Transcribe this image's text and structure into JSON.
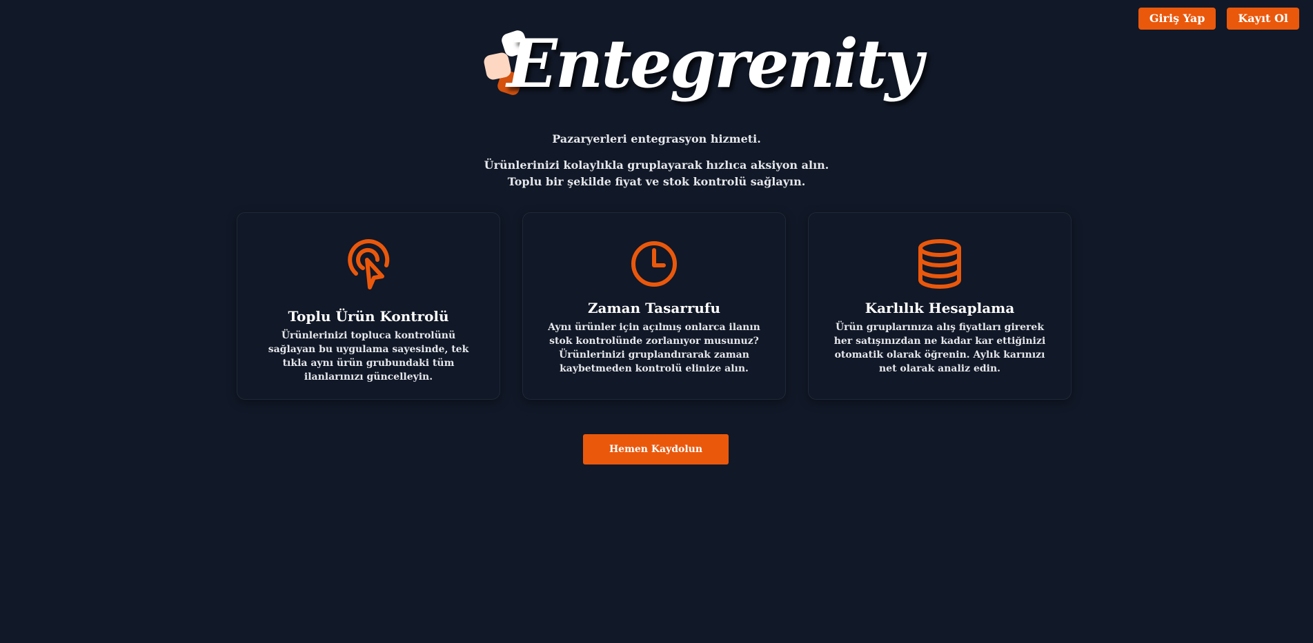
{
  "nav": {
    "login_label": "Giriş Yap",
    "register_label": "Kayıt Ol"
  },
  "brand": {
    "name": "Entegrenity",
    "accent_color": "#ea580c"
  },
  "hero": {
    "tagline": "Pazaryerleri entegrasyon hizmeti.",
    "description": "Ürünlerinizi kolaylıkla gruplayarak hızlıca aksiyon alın. Toplu bir şekilde fiyat ve stok kontrolü sağlayın."
  },
  "features": [
    {
      "icon": "cursor-click-icon",
      "title": "Toplu Ürün Kontrolü",
      "text": "Ürünlerinizi topluca kontrolünü sağlayan bu uygulama sayesinde, tek tıkla aynı ürün grubundaki tüm ilanlarınızı güncelleyin."
    },
    {
      "icon": "clock-icon",
      "title": "Zaman Tasarrufu",
      "text": "Aynı ürünler için açılmış onlarca ilanın stok kontrolünde zorlanıyor musunuz? Ürünlerinizi gruplandırarak zaman kaybetmeden kontrolü elinize alın."
    },
    {
      "icon": "database-icon",
      "title": "Karlılık Hesaplama",
      "text": "Ürün gruplarınıza alış fiyatları girerek her satışınızdan ne kadar kar ettiğinizi otomatik olarak öğrenin. Aylık karınızı net olarak analiz edin."
    }
  ],
  "cta": {
    "label": "Hemen Kaydolun"
  }
}
